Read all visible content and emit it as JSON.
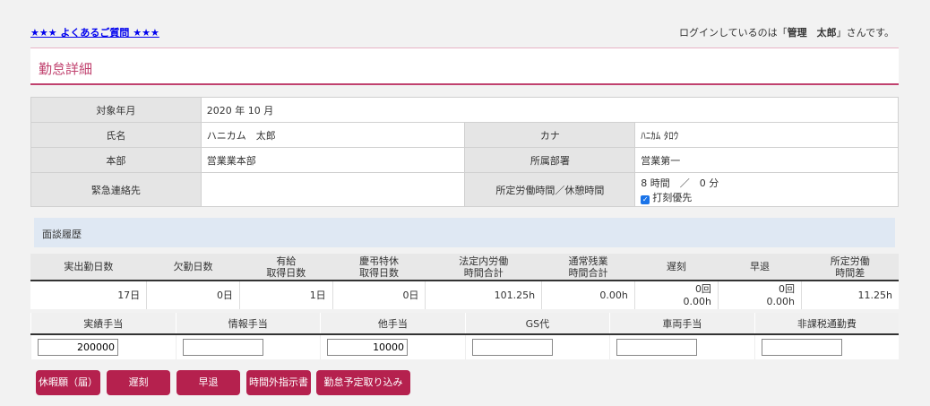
{
  "header": {
    "faq_link": "★★★ よくあるご質問 ★★★",
    "login_prefix": "ログインしているのは「",
    "login_user": "管理　太郎",
    "login_suffix": "」さんです。"
  },
  "page_title": "勤怠詳細",
  "info": {
    "target_month_label": "対象年月",
    "target_month": "2020 年 10 月",
    "name_label": "氏名",
    "name": "ハニカム　太郎",
    "kana_label": "カナ",
    "kana": "ﾊﾆｶﾑ ﾀﾛｳ",
    "division_label": "本部",
    "division": "営業業本部",
    "department_label": "所属部署",
    "department": "営業第一",
    "emergency_label": "緊急連絡先",
    "emergency": "",
    "work_hours_label": "所定労働時間／休憩時間",
    "work_hours": "8 時間　／　0 分",
    "clock_priority_label": "打刻優先"
  },
  "history_label": "面談履歴",
  "stats": {
    "headers": [
      [
        "実出勤日数",
        ""
      ],
      [
        "欠勤日数",
        ""
      ],
      [
        "有給",
        "取得日数"
      ],
      [
        "慶弔特休",
        "取得日数"
      ],
      [
        "法定内労働",
        "時間合計"
      ],
      [
        "通常残業",
        "時間合計"
      ],
      [
        "遅刻",
        ""
      ],
      [
        "早退",
        ""
      ],
      [
        "所定労働",
        "時間差"
      ]
    ],
    "values": [
      [
        "17日",
        ""
      ],
      [
        "0日",
        ""
      ],
      [
        "1日",
        ""
      ],
      [
        "0日",
        ""
      ],
      [
        "101.25h",
        ""
      ],
      [
        "0.00h",
        ""
      ],
      [
        "0回",
        "0.00h"
      ],
      [
        "0回",
        "0.00h"
      ],
      [
        "11.25h",
        ""
      ]
    ]
  },
  "allowances": {
    "headers": [
      "実績手当",
      "情報手当",
      "他手当",
      "GS代",
      "車両手当",
      "非課税通勤費"
    ],
    "values": [
      "200000",
      "",
      "10000",
      "",
      "",
      ""
    ]
  },
  "buttons": {
    "leave_request": "休暇願（届）",
    "late": "遅刻",
    "early_leave": "早退",
    "overtime_order": "時間外指示書",
    "import_schedule": "勤怠予定取り込み"
  },
  "colors": {
    "accent": "#c0416e",
    "button_bg": "#b5214e",
    "link": "#0000ee",
    "history_bg": "#dfe8f3"
  }
}
